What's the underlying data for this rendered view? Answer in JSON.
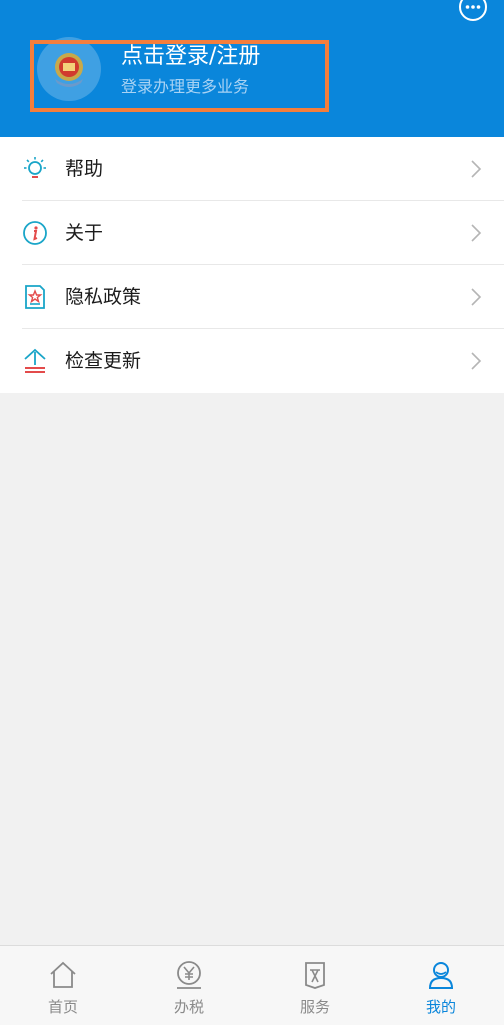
{
  "header": {
    "login_title": "点击登录/注册",
    "login_subtitle": "登录办理更多业务",
    "message_icon": "chat-bubble-icon",
    "avatar_icon": "tax-emblem-icon",
    "highlight_color": "#f47e3c",
    "background_color": "#0a86db"
  },
  "menu": {
    "items": [
      {
        "label": "帮助",
        "icon": "lightbulb-icon"
      },
      {
        "label": "关于",
        "icon": "info-icon"
      },
      {
        "label": "隐私政策",
        "icon": "privacy-document-icon"
      },
      {
        "label": "检查更新",
        "icon": "update-arrow-icon"
      }
    ]
  },
  "tabbar": {
    "tabs": [
      {
        "label": "首页",
        "icon": "home-icon",
        "active": false
      },
      {
        "label": "办税",
        "icon": "tax-yen-icon",
        "active": false
      },
      {
        "label": "服务",
        "icon": "service-tag-icon",
        "active": false
      },
      {
        "label": "我的",
        "icon": "user-icon",
        "active": true
      }
    ],
    "active_color": "#0a86db",
    "inactive_color": "#8a8a8a"
  }
}
